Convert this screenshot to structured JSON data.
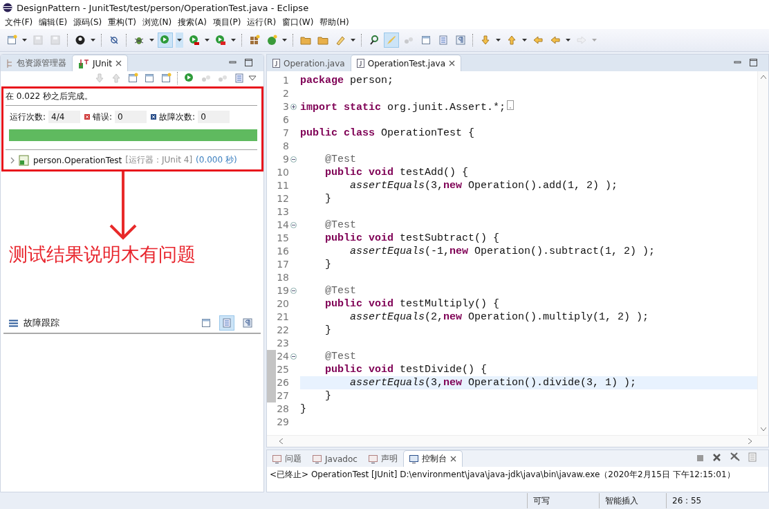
{
  "window": {
    "title": "DesignPattern - JunitTest/test/person/OperationTest.java - Eclipse"
  },
  "menu": [
    "文件(F)",
    "编辑(E)",
    "源码(S)",
    "重构(T)",
    "浏览(N)",
    "搜索(A)",
    "项目(P)",
    "运行(R)",
    "窗口(W)",
    "帮助(H)"
  ],
  "toolbar": [
    {
      "kind": "button",
      "dropdown": true,
      "selected": false,
      "disabled": false
    },
    {
      "kind": "button",
      "dropdown": false,
      "selected": false,
      "disabled": true
    },
    {
      "kind": "button",
      "dropdown": false,
      "selected": false,
      "disabled": true
    },
    {
      "kind": "separator"
    },
    {
      "kind": "button",
      "dropdown": true,
      "selected": false,
      "disabled": false
    },
    {
      "kind": "separator"
    },
    {
      "kind": "button",
      "dropdown": false,
      "selected": false,
      "disabled": false
    },
    {
      "kind": "separator"
    },
    {
      "kind": "button",
      "dropdown": true,
      "selected": false,
      "disabled": false
    },
    {
      "kind": "button",
      "dropdown": true,
      "selected": true,
      "disabled": false
    },
    {
      "kind": "button",
      "dropdown": true,
      "selected": false,
      "disabled": false
    },
    {
      "kind": "button",
      "dropdown": true,
      "selected": false,
      "disabled": false
    },
    {
      "kind": "separator"
    },
    {
      "kind": "button",
      "dropdown": false,
      "selected": false,
      "disabled": false
    },
    {
      "kind": "button",
      "dropdown": true,
      "selected": false,
      "disabled": false
    },
    {
      "kind": "separator"
    },
    {
      "kind": "button",
      "dropdown": false,
      "selected": false,
      "disabled": false
    },
    {
      "kind": "button",
      "dropdown": false,
      "selected": false,
      "disabled": false
    },
    {
      "kind": "button",
      "dropdown": true,
      "selected": false,
      "disabled": false
    },
    {
      "kind": "separator"
    },
    {
      "kind": "button",
      "dropdown": false,
      "selected": false,
      "disabled": false
    },
    {
      "kind": "button",
      "dropdown": false,
      "selected": true,
      "disabled": false
    },
    {
      "kind": "button",
      "dropdown": false,
      "selected": false,
      "disabled": true
    },
    {
      "kind": "button",
      "dropdown": false,
      "selected": false,
      "disabled": false
    },
    {
      "kind": "button",
      "dropdown": false,
      "selected": false,
      "disabled": false
    },
    {
      "kind": "button",
      "dropdown": false,
      "selected": false,
      "disabled": false
    },
    {
      "kind": "separator"
    },
    {
      "kind": "button",
      "dropdown": true,
      "selected": false,
      "disabled": false
    },
    {
      "kind": "button",
      "dropdown": true,
      "selected": false,
      "disabled": false
    },
    {
      "kind": "button",
      "dropdown": false,
      "selected": false,
      "disabled": false
    },
    {
      "kind": "button",
      "dropdown": true,
      "selected": false,
      "disabled": false
    },
    {
      "kind": "button",
      "dropdown": true,
      "selected": false,
      "disabled": true
    }
  ],
  "left_tabs": [
    {
      "label": "包资源管理器",
      "selected": false
    },
    {
      "label": "JUnit",
      "selected": true
    }
  ],
  "junit_toolbar": [
    {
      "disabled": true
    },
    {
      "disabled": true
    },
    {
      "disabled": false
    },
    {
      "disabled": false
    },
    {
      "disabled": false
    },
    {
      "disabled": false
    },
    {
      "disabled": true
    },
    {
      "disabled": true
    },
    {
      "disabled": false
    }
  ],
  "junit": {
    "status": "在 0.022 秒之后完成。",
    "counters": [
      {
        "kind": "runs",
        "label": "运行次数:",
        "value": "4/4"
      },
      {
        "kind": "error",
        "label": "错误:",
        "value": "0"
      },
      {
        "kind": "failure",
        "label": "故障次数:",
        "value": "0"
      }
    ],
    "progress": {
      "level": 1,
      "passed": true
    },
    "tree": [
      {
        "name": "person.OperationTest",
        "runner": "[运行器：JUnit 4]",
        "time": "(0.000 秒)",
        "expanded": false
      }
    ]
  },
  "annotation": {
    "text": "测试结果说明木有问题"
  },
  "failure_trace": {
    "title": "故障跟踪",
    "buttons": [
      {
        "selected": false
      },
      {
        "selected": true
      },
      {
        "selected": false
      }
    ]
  },
  "editor_tabs": [
    {
      "label": "Operation.java",
      "selected": false
    },
    {
      "label": "OperationTest.java",
      "selected": true
    }
  ],
  "code": [
    {
      "num": "1",
      "fold_marker": false,
      "marked": false,
      "current": false,
      "segs": [
        {
          "kind": "kw",
          "text": "package"
        },
        {
          "kind": "plain",
          "text": " person;"
        }
      ]
    },
    {
      "num": "2",
      "fold_marker": false,
      "marked": false,
      "current": false
    },
    {
      "num": "3",
      "fold_marker": true,
      "collapsed": true,
      "marked": false,
      "current": false,
      "segs": [
        {
          "kind": "kw",
          "text": "import static"
        },
        {
          "kind": "plain",
          "text": " org.junit.Assert.*;"
        }
      ]
    },
    {
      "num": "6",
      "fold_marker": false,
      "marked": false,
      "current": false
    },
    {
      "num": "7",
      "fold_marker": false,
      "marked": false,
      "current": false,
      "segs": [
        {
          "kind": "kw",
          "text": "public class"
        },
        {
          "kind": "plain",
          "text": " OperationTest {"
        }
      ]
    },
    {
      "num": "8",
      "fold_marker": false,
      "marked": false,
      "current": false
    },
    {
      "num": "9",
      "fold_marker": true,
      "collapsed": false,
      "marked": false,
      "current": false,
      "segs": [
        {
          "kind": "ann",
          "text": "    @Test"
        }
      ]
    },
    {
      "num": "10",
      "fold_marker": false,
      "marked": false,
      "current": false,
      "segs": [
        {
          "kind": "kw",
          "text": "    public void"
        },
        {
          "kind": "plain",
          "text": " testAdd() {"
        }
      ]
    },
    {
      "num": "11",
      "fold_marker": false,
      "marked": false,
      "current": false,
      "segs": [
        {
          "kind": "it",
          "text": "        assertEquals"
        },
        {
          "kind": "plain",
          "text": "(3,"
        },
        {
          "kind": "kw",
          "text": "new"
        },
        {
          "kind": "plain",
          "text": " Operation().add(1, 2) );"
        }
      ]
    },
    {
      "num": "12",
      "fold_marker": false,
      "marked": false,
      "current": false,
      "segs": [
        {
          "kind": "plain",
          "text": "    }"
        }
      ]
    },
    {
      "num": "13",
      "fold_marker": false,
      "marked": false,
      "current": false
    },
    {
      "num": "14",
      "fold_marker": true,
      "collapsed": false,
      "marked": false,
      "current": false,
      "segs": [
        {
          "kind": "ann",
          "text": "    @Test"
        }
      ]
    },
    {
      "num": "15",
      "fold_marker": false,
      "marked": false,
      "current": false,
      "segs": [
        {
          "kind": "kw",
          "text": "    public void"
        },
        {
          "kind": "plain",
          "text": " testSubtract() {"
        }
      ]
    },
    {
      "num": "16",
      "fold_marker": false,
      "marked": false,
      "current": false,
      "segs": [
        {
          "kind": "it",
          "text": "        assertEquals"
        },
        {
          "kind": "plain",
          "text": "(-1,"
        },
        {
          "kind": "kw",
          "text": "new"
        },
        {
          "kind": "plain",
          "text": " Operation().subtract(1, 2) );"
        }
      ]
    },
    {
      "num": "17",
      "fold_marker": false,
      "marked": false,
      "current": false,
      "segs": [
        {
          "kind": "plain",
          "text": "    }"
        }
      ]
    },
    {
      "num": "18",
      "fold_marker": false,
      "marked": false,
      "current": false
    },
    {
      "num": "19",
      "fold_marker": true,
      "collapsed": false,
      "marked": false,
      "current": false,
      "segs": [
        {
          "kind": "ann",
          "text": "    @Test"
        }
      ]
    },
    {
      "num": "20",
      "fold_marker": false,
      "marked": false,
      "current": false,
      "segs": [
        {
          "kind": "kw",
          "text": "    public void"
        },
        {
          "kind": "plain",
          "text": " testMultiply() {"
        }
      ]
    },
    {
      "num": "21",
      "fold_marker": false,
      "marked": false,
      "current": false,
      "segs": [
        {
          "kind": "it",
          "text": "        assertEquals"
        },
        {
          "kind": "plain",
          "text": "(2,"
        },
        {
          "kind": "kw",
          "text": "new"
        },
        {
          "kind": "plain",
          "text": " Operation().multiply(1, 2) );"
        }
      ]
    },
    {
      "num": "22",
      "fold_marker": false,
      "marked": false,
      "current": false,
      "segs": [
        {
          "kind": "plain",
          "text": "    }"
        }
      ]
    },
    {
      "num": "23",
      "fold_marker": false,
      "marked": false,
      "current": false
    },
    {
      "num": "24",
      "fold_marker": true,
      "collapsed": false,
      "marked": true,
      "current": false,
      "segs": [
        {
          "kind": "ann",
          "text": "    @Test"
        }
      ]
    },
    {
      "num": "25",
      "fold_marker": false,
      "marked": true,
      "current": false,
      "segs": [
        {
          "kind": "kw",
          "text": "    public void"
        },
        {
          "kind": "plain",
          "text": " testDivide() {"
        }
      ]
    },
    {
      "num": "26",
      "fold_marker": false,
      "marked": true,
      "current": true,
      "segs": [
        {
          "kind": "it",
          "text": "        assertEquals"
        },
        {
          "kind": "plain",
          "text": "(3,"
        },
        {
          "kind": "kw",
          "text": "new"
        },
        {
          "kind": "plain",
          "text": " Operation().divide(3, 1) );"
        }
      ]
    },
    {
      "num": "27",
      "fold_marker": false,
      "marked": true,
      "current": false,
      "segs": [
        {
          "kind": "plain",
          "text": "    }"
        }
      ]
    },
    {
      "num": "28",
      "fold_marker": false,
      "marked": false,
      "current": false,
      "segs": [
        {
          "kind": "plain",
          "text": "}"
        }
      ]
    },
    {
      "num": "29",
      "fold_marker": false,
      "marked": false,
      "current": false
    }
  ],
  "bottom_tabs": [
    {
      "label": "问题",
      "selected": false
    },
    {
      "label": "Javadoc",
      "selected": false
    },
    {
      "label": "声明",
      "selected": false
    },
    {
      "label": "控制台",
      "selected": true
    }
  ],
  "console": "<已终止> OperationTest [JUnit] D:\\environment\\java\\java-jdk\\java\\bin\\javaw.exe（2020年2月15日 下午12:15:01）",
  "status_bar": [
    "可写",
    "智能插入",
    "26 : 55"
  ]
}
